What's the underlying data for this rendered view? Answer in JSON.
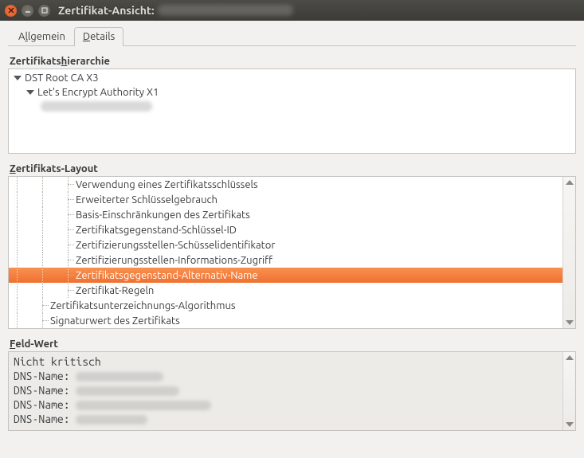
{
  "window": {
    "title": "Zertifikat-Ansicht:"
  },
  "tabs": {
    "general_pre": "A",
    "general_accel": "l",
    "general_post": "lgemein",
    "details_pre": "",
    "details_accel": "D",
    "details_post": "etails"
  },
  "sections": {
    "hierarchy_pre": "Zertifikats",
    "hierarchy_accel": "h",
    "hierarchy_post": "ierarchie",
    "layout_pre": "",
    "layout_accel": "Z",
    "layout_post": "ertifikats-Layout",
    "fieldvalue_pre": "",
    "fieldvalue_accel": "F",
    "fieldvalue_post": "eld-Wert"
  },
  "hierarchy": {
    "root": "DST Root CA X3",
    "intermediate": "Let's Encrypt Authority X1"
  },
  "layout_items": [
    "Verwendung eines Zertifikatsschlüssels",
    "Erweiterter Schlüsselgebrauch",
    "Basis-Einschränkungen des Zertifikats",
    "Zertifikatsgegenstand-Schlüssel-ID",
    "Zertifizierungsstellen-Schüsselidentifikator",
    "Zertifizierungsstellen-Informations-Zugriff",
    "Zertifikatsgegenstand-Alternativ-Name",
    "Zertifikat-Regeln",
    "Zertifikatsunterzeichnungs-Algorithmus",
    "Signaturwert des Zertifikats"
  ],
  "selected_index": 6,
  "fieldvalue": {
    "line0": "Nicht kritisch",
    "label": "DNS-Name:"
  }
}
